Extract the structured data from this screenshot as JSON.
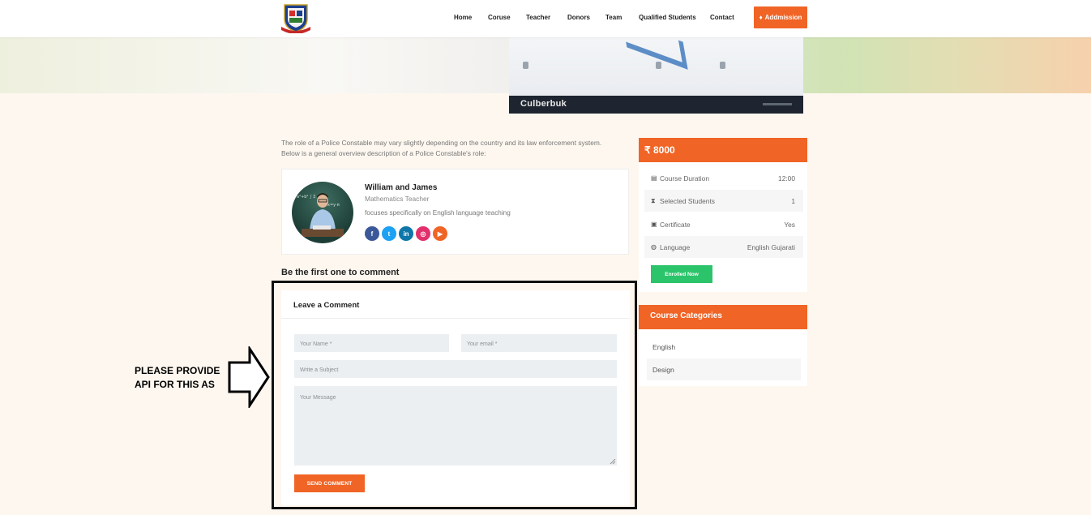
{
  "header": {
    "nav": [
      "Home",
      "Coruse",
      "Teacher",
      "Donors",
      "Team",
      "Qualified Students",
      "Contact"
    ],
    "admission_label": "Addmission"
  },
  "hero": {
    "banner_text": "Culberbuk"
  },
  "intro": "The role of a Police Constable may vary slightly depending on the country and its law enforcement system. Below is a general overview description of a Police Constable's role:",
  "teacher": {
    "name": "William and James",
    "role": "Mathematics Teacher",
    "description": "focuses specifically on English language teaching",
    "socials": [
      {
        "icon": "facebook-icon",
        "glyph": "f",
        "color": "#3b5998"
      },
      {
        "icon": "twitter-icon",
        "glyph": "t",
        "color": "#1da1f2"
      },
      {
        "icon": "linkedin-icon",
        "glyph": "in",
        "color": "#0e76a8"
      },
      {
        "icon": "instagram-icon",
        "glyph": "◎",
        "color": "#e1306c"
      },
      {
        "icon": "youtube-icon",
        "glyph": "▶",
        "color": "#f06426"
      }
    ]
  },
  "comments": {
    "first_comment_heading": "Be the first one to comment",
    "form_title": "Leave a Comment",
    "name_placeholder": "Your Name *",
    "email_placeholder": "Your email *",
    "subject_placeholder": "Write a Subject",
    "message_placeholder": "Your Message",
    "send_label": "SEND COMMENT"
  },
  "annotation": {
    "line1": "PLEASE PROVIDE",
    "line2": "API FOR THIS AS"
  },
  "course": {
    "price": "₹ 8000",
    "details": [
      {
        "icon": "book-icon",
        "glyph": "▤",
        "label": "Course Duration",
        "value": "12:00"
      },
      {
        "icon": "hourglass-icon",
        "glyph": "⧗",
        "label": "Selected Students",
        "value": "1"
      },
      {
        "icon": "certificate-icon",
        "glyph": "▣",
        "label": "Certificate",
        "value": "Yes"
      },
      {
        "icon": "globe-icon",
        "glyph": "◍",
        "label": "Language",
        "value": "English Gujarati"
      }
    ],
    "enroll_label": "Enrolled Now"
  },
  "categories": {
    "title": "Course Categories",
    "items": [
      "English",
      "Design"
    ]
  },
  "colors": {
    "accent": "#f06426",
    "success": "#2cc46b"
  }
}
